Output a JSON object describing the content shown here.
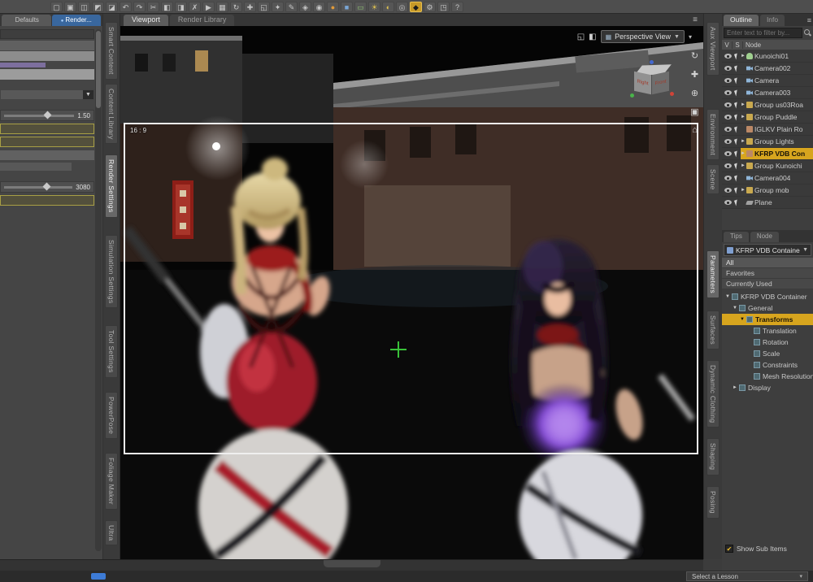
{
  "ui": {
    "pane_menu_glyph": "≡",
    "caret_down": "▼",
    "caret_small": "▾",
    "check_glyph": "✔",
    "combo_caret": "▼"
  },
  "toolbar": {
    "icons": [
      {
        "name": "file-new-icon",
        "glyph": "▢"
      },
      {
        "name": "file-open-icon",
        "glyph": "▣"
      },
      {
        "name": "file-save-icon",
        "glyph": "◫"
      },
      {
        "name": "import-icon",
        "glyph": "◩"
      },
      {
        "name": "export-icon",
        "glyph": "◪"
      },
      {
        "name": "undo-icon",
        "glyph": "↶"
      },
      {
        "name": "redo-icon",
        "glyph": "↷"
      },
      {
        "name": "cut-icon",
        "glyph": "✂"
      },
      {
        "name": "copy-icon",
        "glyph": "◧"
      },
      {
        "name": "paste-icon",
        "glyph": "◨"
      },
      {
        "name": "delete-icon",
        "glyph": "✗"
      },
      {
        "name": "node-selection-tool-icon",
        "glyph": "▶"
      },
      {
        "name": "geometry-editor-tool-icon",
        "glyph": "▦"
      },
      {
        "name": "rotate-tool-icon",
        "glyph": "↻"
      },
      {
        "name": "translate-tool-icon",
        "glyph": "✚"
      },
      {
        "name": "scale-tool-icon",
        "glyph": "◱"
      },
      {
        "name": "universal-tool-icon",
        "glyph": "✦"
      },
      {
        "name": "active-pose-tool-icon",
        "glyph": "✎"
      },
      {
        "name": "surface-selection-tool-icon",
        "glyph": "◈"
      },
      {
        "name": "region-navigator-tool-icon",
        "glyph": "◉"
      },
      {
        "name": "primitive-sphere-icon",
        "glyph": "●",
        "cls": "c-orange"
      },
      {
        "name": "primitive-cube-icon",
        "glyph": "■",
        "cls": "c-blue"
      },
      {
        "name": "primitive-plane-icon",
        "glyph": "▭",
        "cls": "c-green"
      },
      {
        "name": "distant-light-icon",
        "glyph": "☀",
        "cls": "c-yellow"
      },
      {
        "name": "spotlight-icon",
        "glyph": "◐",
        "cls": "c-yellow"
      },
      {
        "name": "camera-create-icon",
        "glyph": "◎"
      },
      {
        "name": "render-icon",
        "glyph": "◆",
        "cls": "hl"
      },
      {
        "name": "render-settings-icon",
        "glyph": "⚙"
      },
      {
        "name": "aux-viewport-icon",
        "glyph": "◳"
      },
      {
        "name": "help-icon",
        "glyph": "?"
      }
    ]
  },
  "left_panel": {
    "tabs": [
      {
        "label": "Defaults"
      },
      {
        "label": "Render...",
        "active": true,
        "icon": "●"
      }
    ],
    "slider1_value": "1.50",
    "slider2_value": "3080",
    "side_tabs": [
      {
        "label": "Smart Content"
      },
      {
        "label": "Content Library"
      },
      {
        "label": "Render Settings",
        "active": true,
        "cls": "gap8"
      },
      {
        "label": "Simulation Settings",
        "cls": "gap16"
      },
      {
        "label": "Tool Settings",
        "cls": "gap16"
      },
      {
        "label": "PowerPose",
        "cls": "gap12"
      },
      {
        "label": "Foliage Maker",
        "cls": "gap12"
      },
      {
        "label": "Ultra",
        "cls": "gap8"
      }
    ]
  },
  "viewport": {
    "tabs": [
      {
        "label": "Viewport",
        "active": true
      },
      {
        "label": "Render Library"
      }
    ],
    "camera_selector": "Perspective View",
    "camera_dd_icon_glyph": "▦",
    "aspect_label": "16 : 9",
    "cube": {
      "left_face": "Right",
      "right_face": "Front"
    },
    "overlay_icons": [
      {
        "name": "aspect-frame-icon",
        "glyph": "◱"
      },
      {
        "name": "view-settings-icon",
        "glyph": "◧"
      }
    ],
    "tools": [
      {
        "name": "orbit-tool-icon",
        "glyph": "↻"
      },
      {
        "name": "pan-tool-icon",
        "glyph": "✚"
      },
      {
        "name": "zoom-tool-icon",
        "glyph": "⊕"
      },
      {
        "name": "frame-view-icon",
        "glyph": "▣"
      },
      {
        "name": "home-view-icon",
        "glyph": "⌂"
      }
    ]
  },
  "right_panel": {
    "top_tabs": [
      {
        "label": "Outline",
        "active": true
      },
      {
        "label": "Info"
      }
    ],
    "filter_placeholder": "Enter text to filter by...",
    "columns": [
      {
        "label": "V",
        "cls": "cw"
      },
      {
        "label": "S",
        "cls": "cw"
      },
      {
        "label": "Node",
        "cls": "cf"
      }
    ],
    "scene_nodes": [
      {
        "label": "Kunoichi01",
        "arrow": "►",
        "cls": "fig"
      },
      {
        "label": "Camera002",
        "arrow": "",
        "cls": "cam"
      },
      {
        "label": "Camera",
        "arrow": "",
        "cls": "cam"
      },
      {
        "label": "Camera003",
        "arrow": "",
        "cls": "cam"
      },
      {
        "label": "Group us03Roa",
        "arrow": "►",
        "cls": "grp"
      },
      {
        "label": "Group Puddle",
        "arrow": "►",
        "cls": "grp"
      },
      {
        "label": "IGLKV Plain Ro",
        "arrow": "",
        "cls": "prop"
      },
      {
        "label": "Group Lights",
        "arrow": "►",
        "cls": "grp"
      },
      {
        "label": "KFRP VDB Con",
        "arrow": "►",
        "cls": "prop",
        "selected": true
      },
      {
        "label": "Group Kunoichi",
        "arrow": "►",
        "cls": "grp"
      },
      {
        "label": "Camera004",
        "arrow": "",
        "cls": "cam"
      },
      {
        "label": "Group mob",
        "arrow": "►",
        "cls": "grp"
      },
      {
        "label": "Plane",
        "arrow": "",
        "cls": "plane"
      }
    ],
    "mid_tabs": [
      {
        "label": "Tips"
      },
      {
        "label": "Node"
      }
    ],
    "parameters": {
      "selector": "KFRP VDB Container",
      "filters": [
        {
          "label": "All",
          "active": true
        },
        {
          "label": "Favorites"
        },
        {
          "label": "Currently Used"
        }
      ],
      "tree": [
        {
          "label": "KFRP VDB Container",
          "arrow": "▼",
          "indent": 0
        },
        {
          "label": "General",
          "arrow": "▼",
          "indent": 1
        },
        {
          "label": "Transforms",
          "arrow": "▼",
          "indent": 2,
          "selected": true
        },
        {
          "label": "Translation",
          "arrow": "",
          "indent": 3
        },
        {
          "label": "Rotation",
          "arrow": "",
          "indent": 3
        },
        {
          "label": "Scale",
          "arrow": "",
          "indent": 3
        },
        {
          "label": "Constraints",
          "arrow": "",
          "indent": 3
        },
        {
          "label": "Mesh Resolution",
          "arrow": "",
          "indent": 3
        },
        {
          "label": "Display",
          "arrow": "►",
          "indent": 1
        }
      ],
      "show_sub_items_label": "Show Sub Items"
    },
    "side_tabs": [
      {
        "label": "Aux Viewport"
      },
      {
        "label": "Environment",
        "cls": "gap36"
      },
      {
        "label": "Scene"
      },
      {
        "label": "Parameters",
        "active": true,
        "cls": "gap64"
      },
      {
        "label": "Surfaces",
        "cls": "gap10"
      },
      {
        "label": "Dynamic Clothing",
        "cls": "gap8"
      },
      {
        "label": "Shaping",
        "cls": "gap8"
      },
      {
        "label": "Posing",
        "cls": "gap8"
      }
    ]
  },
  "bottom": {
    "lesson_label": "Select a Lesson"
  }
}
